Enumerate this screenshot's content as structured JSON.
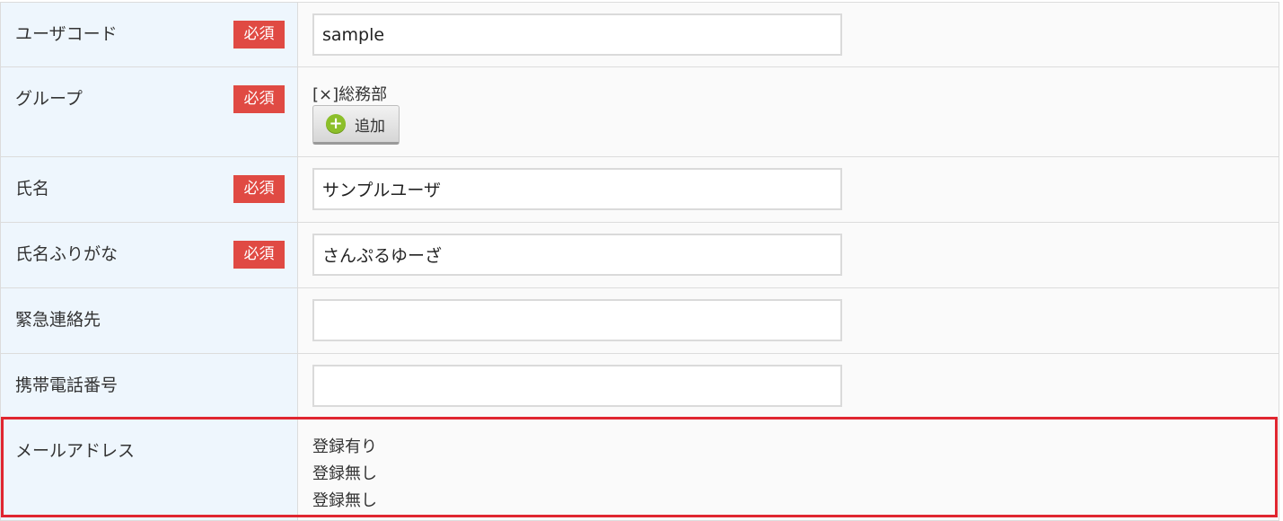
{
  "rows": [
    {
      "label": "ユーザコード",
      "required": "必須",
      "value": "sample"
    },
    {
      "label": "グループ",
      "required": "必須",
      "group_tag": "[×]総務部",
      "add_label": "追加"
    },
    {
      "label": "氏名",
      "required": "必須",
      "value": "サンプルユーザ"
    },
    {
      "label": "氏名ふりがな",
      "required": "必須",
      "value": "さんぷるゆーざ"
    },
    {
      "label": "緊急連絡先",
      "value": ""
    },
    {
      "label": "携帯電話番号",
      "value": ""
    },
    {
      "label": "メールアドレス",
      "mail_status": [
        "登録有り",
        "登録無し",
        "登録無し"
      ]
    }
  ],
  "colors": {
    "label_bg": "#eef6fd",
    "required_badge": "#e04a43",
    "highlight_border": "#e02630",
    "add_icon": "#8cbf2a"
  }
}
